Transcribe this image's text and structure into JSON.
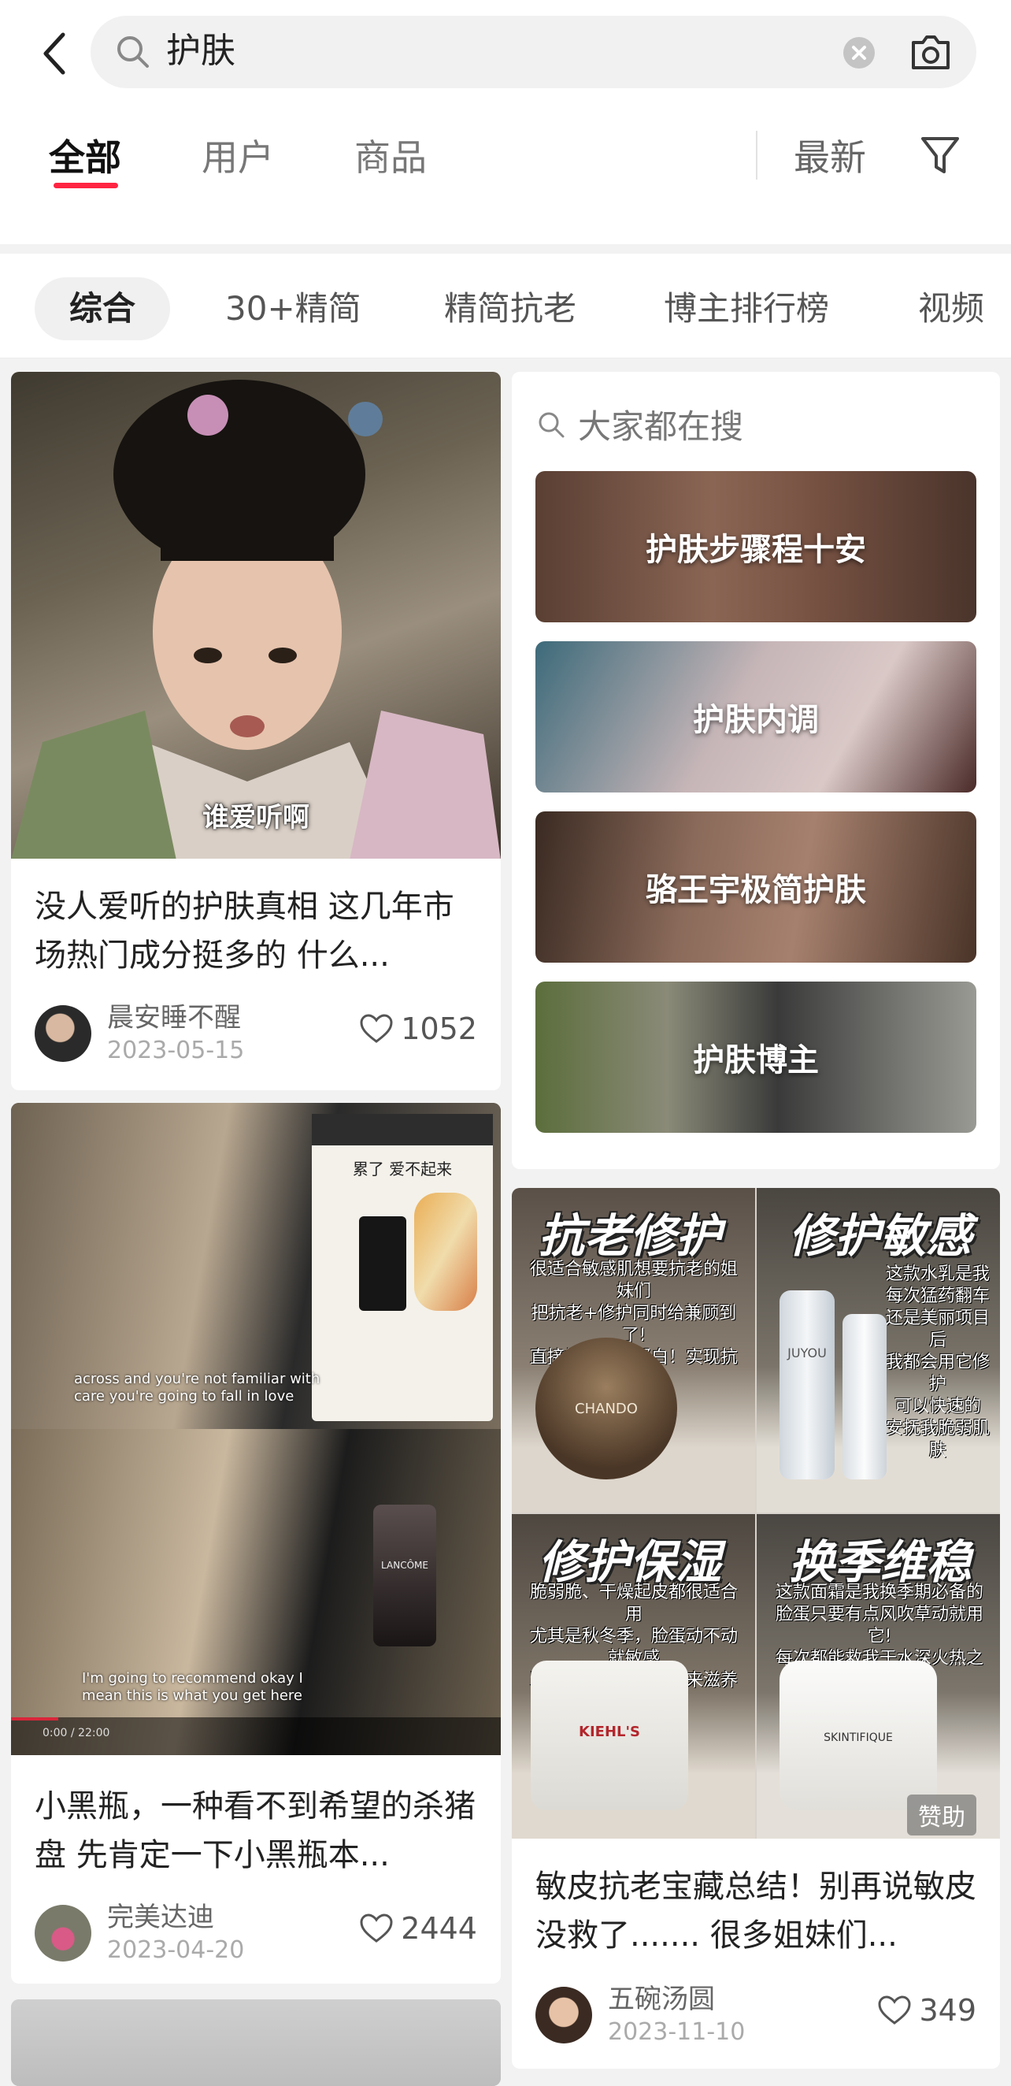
{
  "search": {
    "query": "护肤"
  },
  "tabs": [
    {
      "label": "全部",
      "active": true
    },
    {
      "label": "用户",
      "active": false
    },
    {
      "label": "商品",
      "active": false
    }
  ],
  "sort": {
    "label": "最新"
  },
  "chips": [
    "综合",
    "30+精简",
    "精简抗老",
    "博主排行榜",
    "视频"
  ],
  "trending": {
    "header": "大家都在搜",
    "items": [
      "护肤步骤程十安",
      "护肤内调",
      "骆王宇极简护肤",
      "护肤博主"
    ]
  },
  "cards": [
    {
      "image_caption": "谁爱听啊",
      "title": "没人爱听的护肤真相 这几年市场热门成分挺多的 什么...",
      "author": "晨安睡不醒",
      "date": "2023-05-15",
      "likes": "1052"
    },
    {
      "image_caption_top": "累了 爱不起来",
      "video_sub_1": "across and you're not familiar with care you're going to fall in love",
      "video_sub_2": "I'm going to recommend okay I mean this is what you get here",
      "video_time": "0:00 / 22:00",
      "brand": "LANCÔME",
      "title": "小黑瓶，一种看不到希望的杀猪盘 先肯定一下小黑瓶本...",
      "author": "完美达迪",
      "date": "2023-04-20",
      "likes": "2444"
    },
    {
      "panels": [
        {
          "title": "抗老修护",
          "text": "很适合敏感肌想要抗老的姐妹们\n把抗老+修护同时给兼顾到了!\n直接补充胶原蛋白！实现抗老自由",
          "brand": "CHANDO"
        },
        {
          "title": "修护敏感",
          "text": "这款水乳是我\n每次猛药翻车\n还是美丽项目后\n我都会用它修护\n可以快速的\n安抚我脆弱肌肤",
          "brand": "JUYOU"
        },
        {
          "title": "修护保湿",
          "text": "脆弱脆、干燥起皮都很适合用\n尤其是秋冬季，脸蛋动不动就敏感\n跟爆皮，我都会用它来滋养修护!",
          "brand": "KIEHL'S"
        },
        {
          "title": "换季维稳",
          "text": "这款面霜是我换季期必备的\n脸蛋只要有点风吹草动就用它!\n每次都能救我于水深火热之中!",
          "brand": "SKINTIFIQUE"
        }
      ],
      "sponsor": "赞助",
      "title": "敏皮抗老宝藏总结！别再说敏皮没救了....... 很多姐妹们...",
      "author": "五碗汤圆",
      "date": "2023-11-10",
      "likes": "349"
    }
  ]
}
